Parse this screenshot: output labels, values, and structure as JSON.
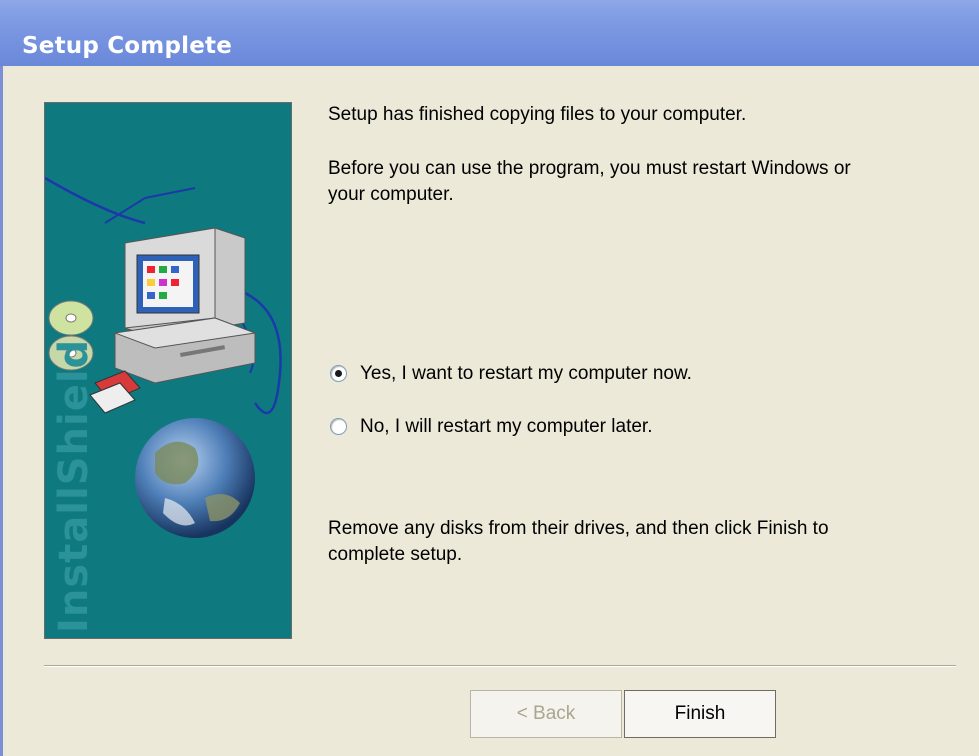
{
  "window": {
    "title": "Setup Complete"
  },
  "side_panel": {
    "brand": "InstallShield"
  },
  "body": {
    "line1": "Setup has finished copying files to your computer.",
    "line2a": "Before you can use the program, you must restart Windows or",
    "line2b": "your computer.",
    "line3a": "Remove any disks from their drives, and then click Finish to",
    "line3b": "complete setup."
  },
  "options": [
    {
      "label": "Yes, I want to restart my computer now.",
      "selected": true
    },
    {
      "label": "No, I will restart my computer later.",
      "selected": false
    }
  ],
  "buttons": {
    "back": "< Back",
    "finish": "Finish"
  },
  "colors": {
    "titlebar": "#7f9be3",
    "panel": "#0e7a80",
    "dialog": "#ece9d8"
  }
}
